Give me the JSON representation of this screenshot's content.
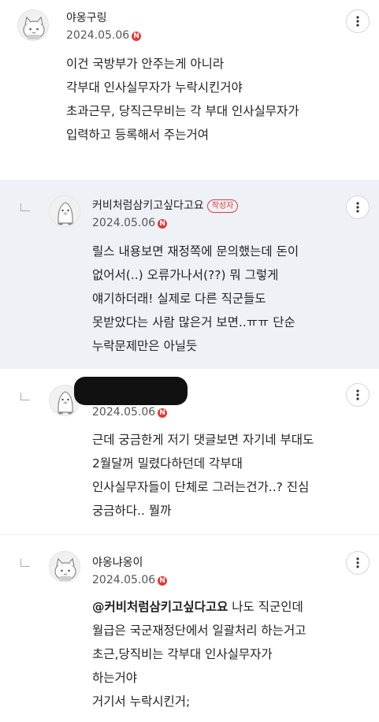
{
  "comments": [
    {
      "nickname": "야옹구링",
      "date": "2024.05.06",
      "new_badge": "N",
      "lines": [
        "이건 국방부가 안주는게 아니라",
        "각부대 인사실무자가 누락시킨거야",
        "초과근무, 당직근무비는 각 부대 인사실무자가",
        "입력하고 등록해서 주는거여"
      ]
    },
    {
      "nickname": "커비처럼삼키고싶다고요",
      "author_tag": "작성자",
      "date": "2024.05.06",
      "new_badge": "N",
      "lines": [
        "릴스 내용보면 재정쪽에 문의했는데 돈이",
        "없어서(..) 오류가나서(??) 뭐 그렇게",
        "얘기하더래! 실제로 다른 직군들도",
        "못받았다는 사람 많은거 보면..ㅠㅠ 단순",
        "누락문제만은 아닐듯"
      ]
    },
    {
      "nickname": "",
      "date": "2024.05.06",
      "new_badge": "N",
      "lines": [
        "근데 궁금한게 저기 댓글보면 자기네 부대도",
        "2월달꺼 밀렸다하던데 각부대",
        "인사실무자들이 단체로 그러는건가..? 진심",
        "궁금하다.. 뭘까"
      ]
    },
    {
      "nickname": "야옹냐옹이",
      "date": "2024.05.06",
      "new_badge": "N",
      "mention": "@커비처럼삼키고싶다고요",
      "first_line_rest": " 나도 직군인데",
      "lines": [
        "월급은 국군재정단에서 일괄처리 하는거고",
        "초근,당직비는 각부대 인사실무자가",
        "하는거야",
        "거기서 누락시킨거;"
      ]
    }
  ],
  "icons": {
    "more": "more-vertical-icon",
    "reply": "reply-arrow-icon",
    "new": "new-badge-icon"
  },
  "colors": {
    "reply_highlight_bg": "#eef2f7",
    "badge_red": "#e23a3a"
  }
}
